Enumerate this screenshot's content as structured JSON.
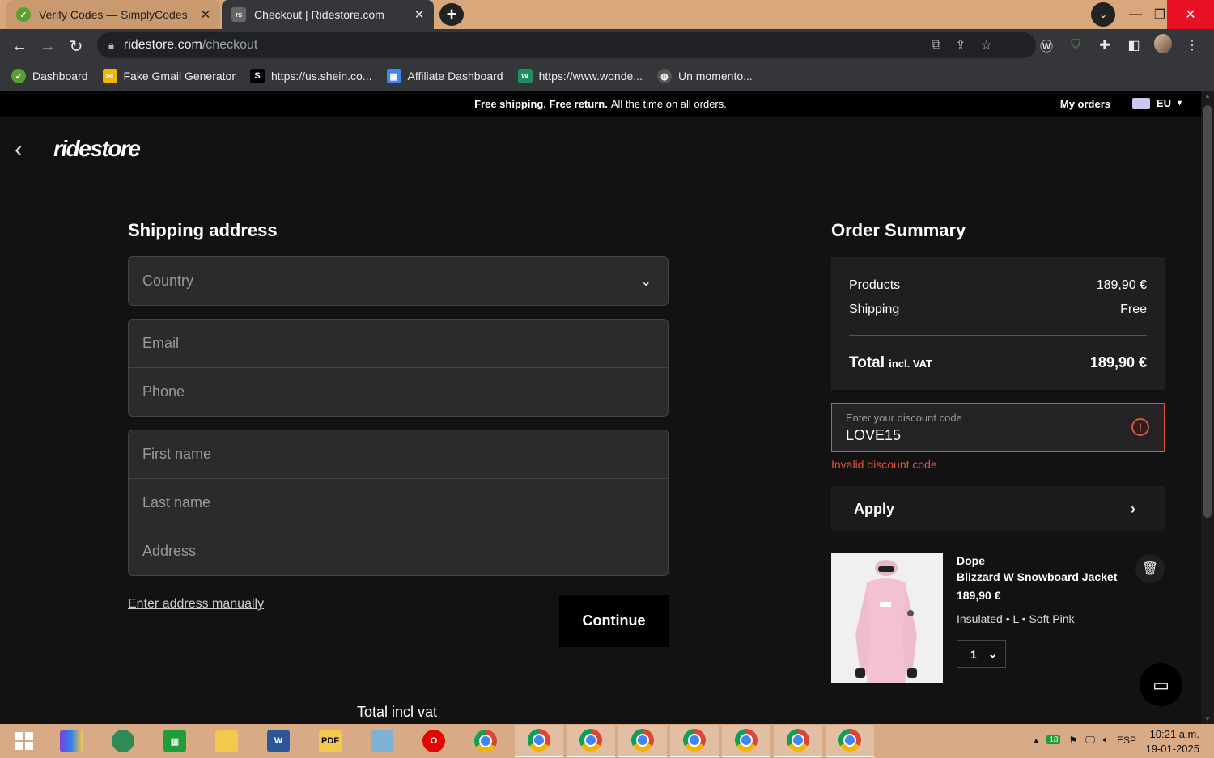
{
  "browser": {
    "tabs": [
      {
        "label": "Verify Codes — SimplyCodes",
        "active": false
      },
      {
        "label": "Checkout | Ridestore.com",
        "active": true
      }
    ],
    "url_host": "ridestore.com",
    "url_path": "/checkout",
    "bookmarks": [
      {
        "label": "Dashboard",
        "icon": "simplycodes-icon",
        "color": "#5aa02c"
      },
      {
        "label": "Fake Gmail Generator",
        "icon": "mail-icon",
        "color": "#f4b400"
      },
      {
        "label": "https://us.shein.co...",
        "icon": "shein-icon",
        "color": "#000000"
      },
      {
        "label": "Affiliate Dashboard",
        "icon": "dashboard-icon",
        "color": "#4285f4"
      },
      {
        "label": "https://www.wonde...",
        "icon": "wondery-icon",
        "color": "#1e8f5e"
      },
      {
        "label": "Un momento...",
        "icon": "globe-icon",
        "color": "#555555"
      }
    ]
  },
  "header": {
    "promo_bold": "Free shipping. Free return.",
    "promo_rest": "All the time on all orders.",
    "my_orders": "My orders",
    "region": "EU",
    "logo": "ridestore"
  },
  "shipping": {
    "title": "Shipping address",
    "country_placeholder": "Country",
    "email_placeholder": "Email",
    "phone_placeholder": "Phone",
    "first_name_placeholder": "First name",
    "last_name_placeholder": "Last name",
    "address_placeholder": "Address",
    "enter_manually": "Enter address manually",
    "continue": "Continue",
    "total_incl": "Total incl vat"
  },
  "summary": {
    "title": "Order Summary",
    "products_label": "Products",
    "products_value": "189,90 €",
    "shipping_label": "Shipping",
    "shipping_value": "Free",
    "total_label": "Total",
    "total_suffix": "incl. VAT",
    "total_value": "189,90 €",
    "discount_label": "Enter your discount code",
    "discount_value": "LOVE15",
    "discount_error": "Invalid discount code",
    "apply": "Apply",
    "accent_error": "#e0533a"
  },
  "product": {
    "brand": "Dope",
    "name": "Blizzard W Snowboard Jacket",
    "price": "189,90 €",
    "variant": "Insulated • L • Soft Pink",
    "quantity": "1"
  },
  "taskbar": {
    "language": "ESP",
    "notification_count": "18",
    "time": "10:21 a.m.",
    "date": "19-01-2025"
  }
}
